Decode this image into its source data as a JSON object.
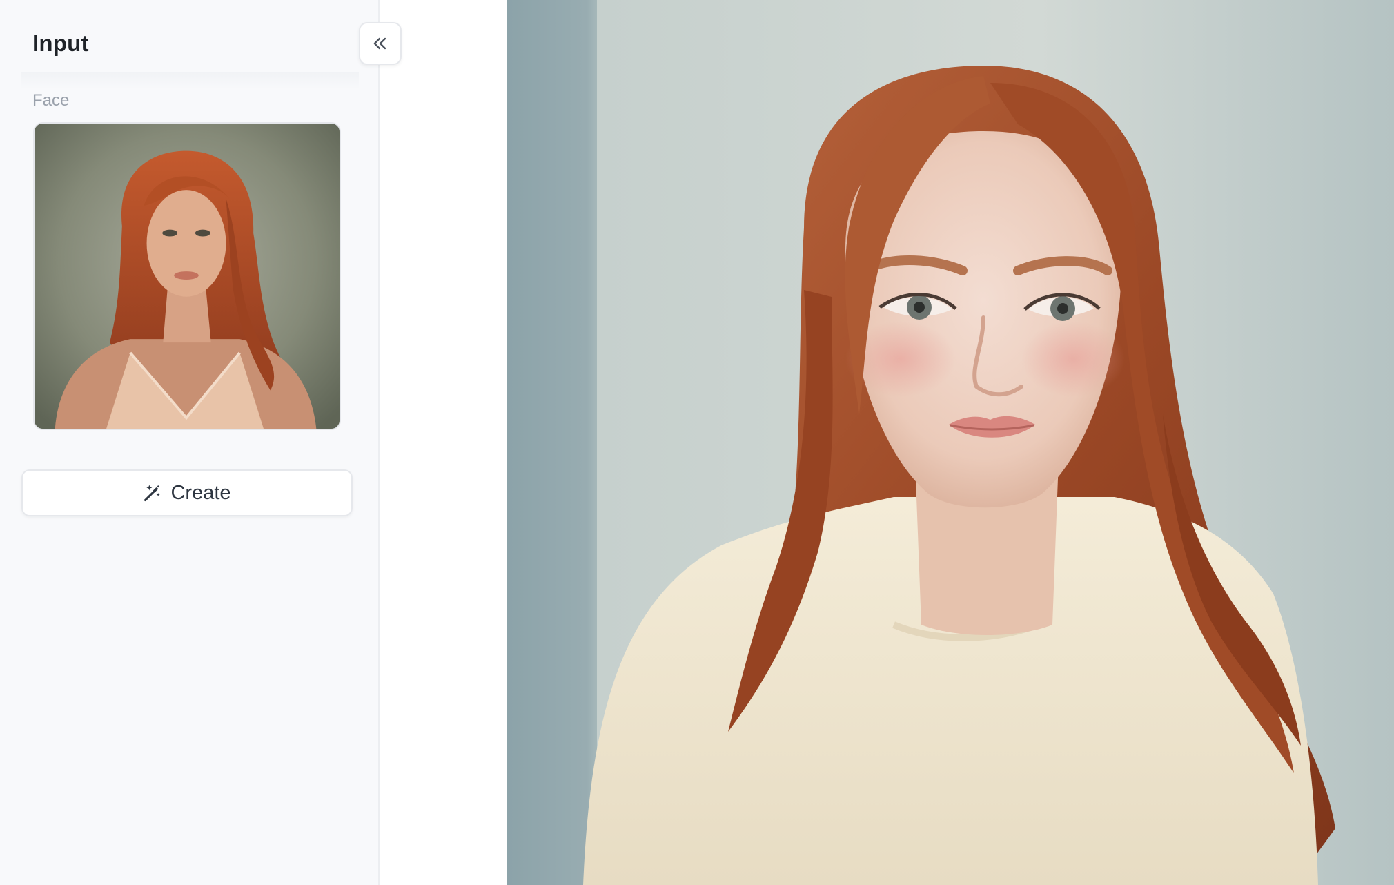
{
  "sidebar": {
    "title": "Input",
    "face_label": "Face",
    "create_button": {
      "label": "Create",
      "icon": "magic-wand-icon"
    },
    "collapse_button": {
      "icon": "chevrons-left-icon"
    }
  },
  "main": {
    "result_image": {
      "kind": "photo-portrait"
    }
  },
  "colors": {
    "sidebar_bg": "#f8f9fb",
    "divider": "#eceef1",
    "title_text": "#1f2328",
    "label_text": "#9aa1ab",
    "button_text": "#2d3540",
    "hair": "#a4522c",
    "wall": "#cfd6d3"
  }
}
